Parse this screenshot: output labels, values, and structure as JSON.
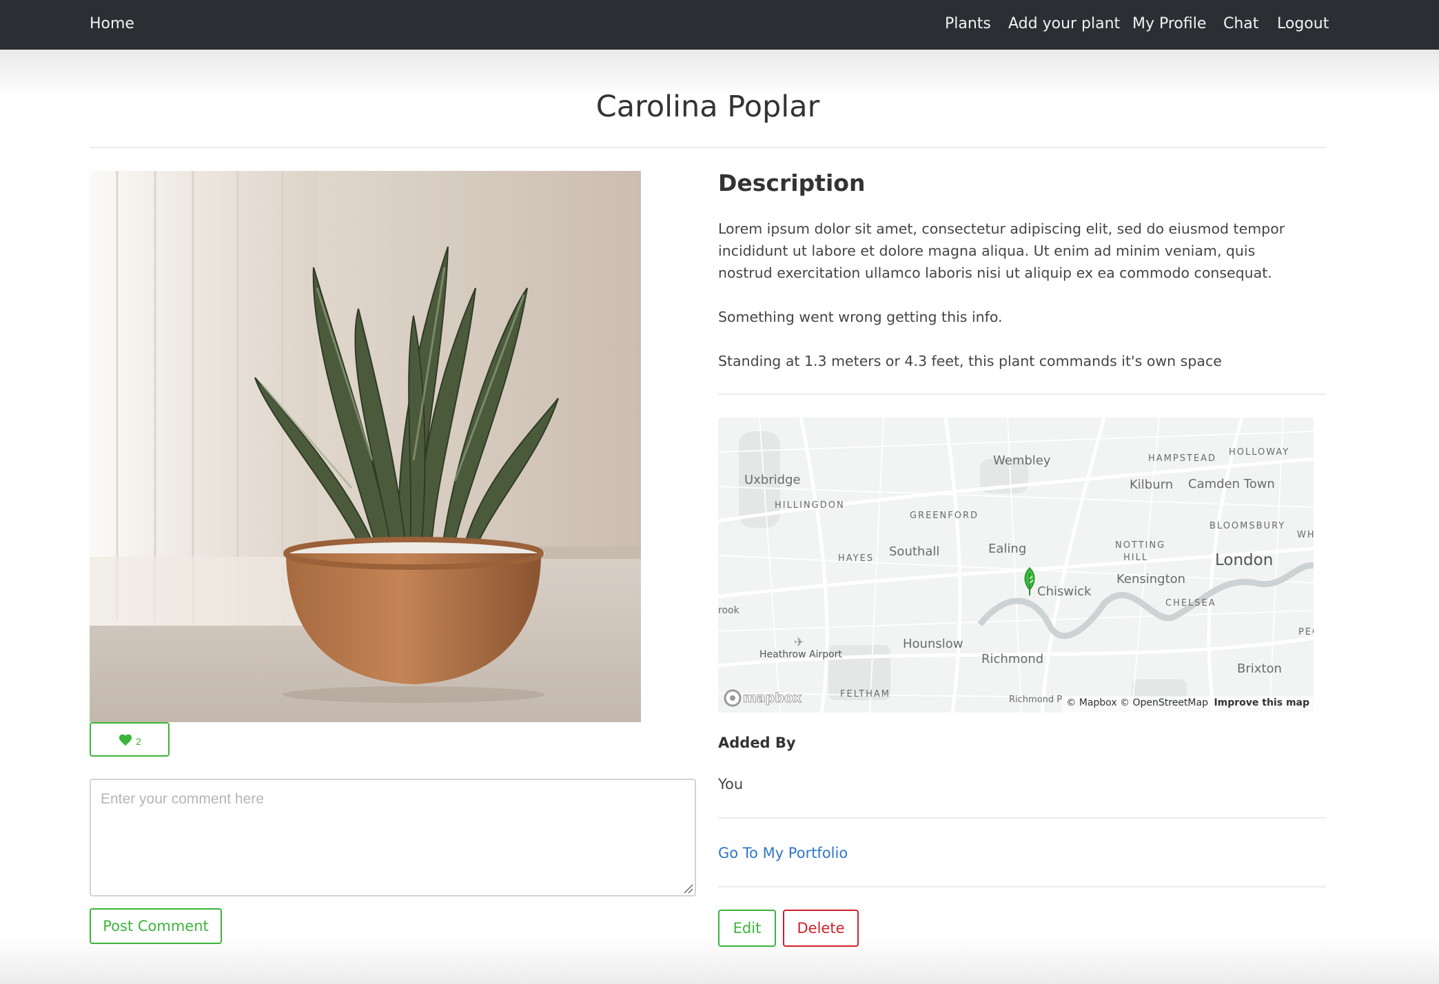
{
  "nav": {
    "home": "Home",
    "links": [
      "Plants",
      "Add your plant",
      "My Profile",
      "Chat",
      "Logout"
    ]
  },
  "plant": {
    "name": "Carolina Poplar",
    "likes": "2"
  },
  "comments": {
    "placeholder": "Enter your comment here",
    "post_label": "Post Comment"
  },
  "description": {
    "heading": "Description",
    "paragraphs": [
      "Lorem ipsum dolor sit amet, consectetur adipiscing elit, sed do eiusmod tempor incididunt ut labore et dolore magna aliqua. Ut enim ad minim veniam, quis nostrud exercitation ullamco laboris nisi ut aliquip ex ea commodo consequat.",
      "Something went wrong getting this info.",
      "Standing at 1.3 meters or 4.3 feet, this plant commands it's own space"
    ]
  },
  "map": {
    "labels": {
      "wembley": "Wembley",
      "hampstead": "HAMPSTEAD",
      "holloway": "HOLLOWAY",
      "uxbridge": "Uxbridge",
      "kilburn": "Kilburn",
      "camden": "Camden Town",
      "hillingdon": "HILLINGDON",
      "greenford": "GREENFORD",
      "bloomsbury": "BLOOMSBURY",
      "whi": "WHI",
      "ealing": "Ealing",
      "notting1": "NOTTING",
      "notting2": "HILL",
      "hayes": "HAYES",
      "southall": "Southall",
      "london": "London",
      "kensington": "Kensington",
      "chiswick": "Chiswick",
      "chelsea": "CHELSEA",
      "rook": "rook",
      "pec": "PEC",
      "heathrow": "Heathrow Airport",
      "hounslow": "Hounslow",
      "richmond": "Richmond",
      "brixton": "Brixton",
      "feltham": "FELTHAM",
      "richmond_p": "Richmond P",
      "mapbox": "mapbox",
      "attribution": "© Mapbox © OpenStreetMap",
      "improve": "Improve this map"
    }
  },
  "owner": {
    "added_by_label": "Added By",
    "added_by_value": "You",
    "portfolio_link": "Go To My Portfolio"
  },
  "actions": {
    "edit": "Edit",
    "delete": "Delete"
  },
  "colors": {
    "accent_green": "#3bb43b",
    "danger_red": "#d01f2a",
    "link_blue": "#2f74c9",
    "navbar": "#2b2f33"
  }
}
